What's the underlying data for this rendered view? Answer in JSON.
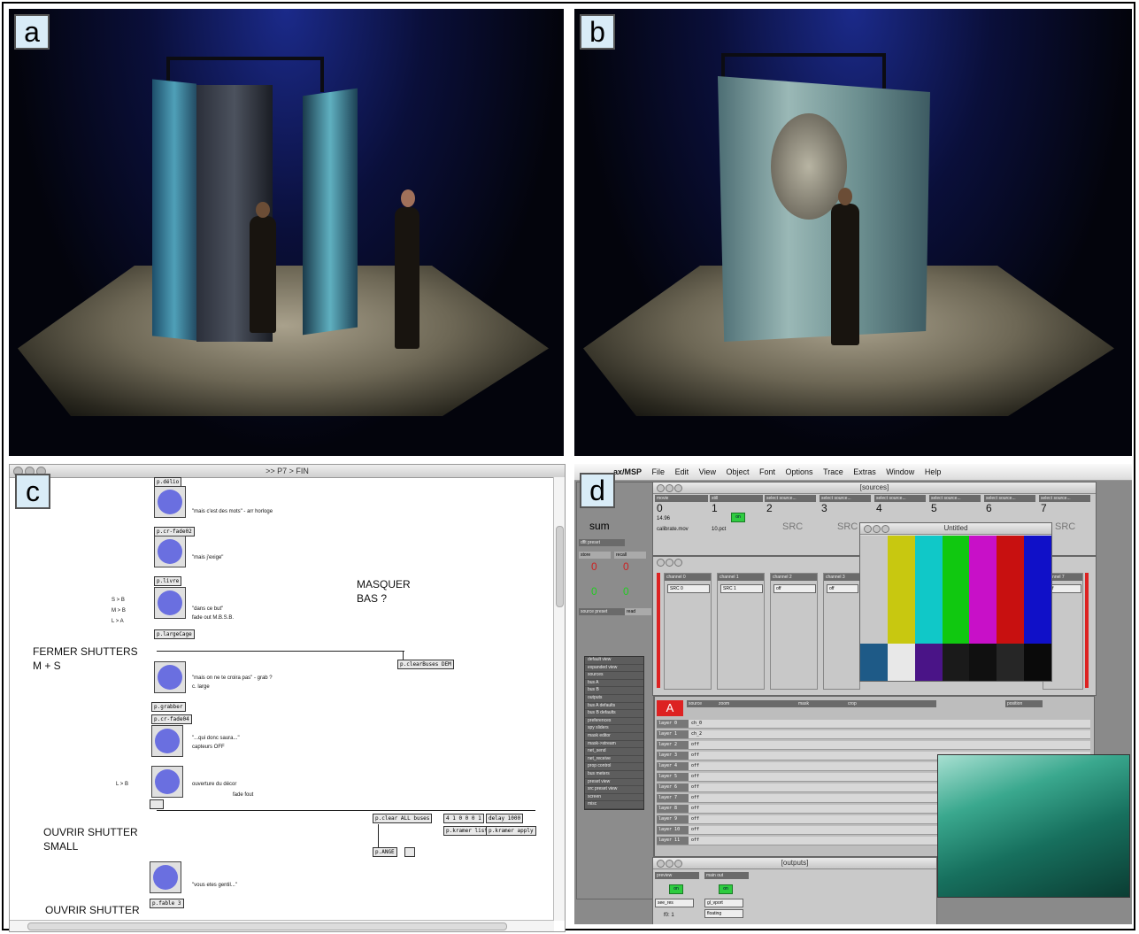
{
  "colors": {
    "stage_blue": "#1b2a8a",
    "bang_blue": "#6a6fe0",
    "max_gray": "#c9c9c9",
    "green_button": "#2ecc40",
    "red_label": "#d22222",
    "colorbars": [
      "#c8c8c8",
      "#c8c810",
      "#10c8c8",
      "#10c810",
      "#c810c8",
      "#c81010",
      "#1010c8"
    ],
    "colorbars_low": [
      "#1e5a87",
      "#e8e8e8",
      "#4a1487",
      "#1a1a1a",
      "#101010",
      "#262626",
      "#0a0a0a"
    ]
  },
  "panels": {
    "a": {
      "label": "a"
    },
    "b": {
      "label": "b"
    },
    "c": {
      "label": "c"
    },
    "d": {
      "label": "d"
    }
  },
  "patch": {
    "window_title": ">> P7 > FIN",
    "objects": {
      "o1": "p.délio",
      "o2": "p.cr-fade02",
      "o3": "p.livre",
      "o4": "p.largeCage",
      "o5": "p.clearBuses DEM",
      "o6": "p.grabber",
      "o7": "p.cr-fade04",
      "o8": "p.clear ALL buses",
      "o9": "4 1 0 0 0 1",
      "o10": "delay 1000",
      "o11": "p.kramer list",
      "o12": "p.kramer apply",
      "o13": "p.ANGE",
      "o14": "p.fable 3"
    },
    "comments": {
      "c1": "\"mais c'est des mots\" - arr horloge",
      "c2": "\"mais j'exige\"",
      "c3": "S > B",
      "c4": "M > B",
      "c5": "L > A",
      "c6": "\"dans ce but\"",
      "c7": "fade out M.B.S.B.",
      "c8": "\"mais on ne te croira pas\" - grab ?",
      "c9": "c. large",
      "c10": "\"...qui donc saura...\"",
      "c11": "capteurs OFF",
      "c12": "L > B",
      "c13": "ouverture du décor",
      "c14": "fade fout",
      "c15": "\"vous etes gentil...\""
    },
    "big_labels": {
      "masquer_1": "MASQUER",
      "masquer_2": "BAS ?",
      "fermer_1": "FERMER SHUTTERS",
      "fermer_2": "M + S",
      "ouvrir_small_1": "OUVRIR SHUTTER",
      "ouvrir_small_2": "SMALL",
      "ouvrir_3": "OUVRIR SHUTTER"
    }
  },
  "maxmsp": {
    "menubar": [
      "ax/MSP",
      "File",
      "Edit",
      "View",
      "Object",
      "Font",
      "Options",
      "Trace",
      "Extras",
      "Window",
      "Help"
    ],
    "sources_title": "[sources]",
    "untitled_title": "Untitled",
    "outputs_title": "[outputs]",
    "sum_label": "sum",
    "movie_hdr": "movie",
    "still_hdr": "still",
    "select_source": "select source...",
    "sources": [
      "0",
      "1",
      "2",
      "3",
      "4",
      "5",
      "6",
      "7"
    ],
    "src_text": "SRC",
    "movie_file": "calibrate.mov",
    "still_file": "10.pct",
    "time_value": "14.96",
    "on_label": "on",
    "channels": [
      "channel 0",
      "channel 1",
      "channel 2",
      "channel 3",
      "channel 7"
    ],
    "channel_values": [
      "SRC 0",
      "SRC 1",
      "off",
      "off",
      "off"
    ],
    "red_a": "A",
    "matrix_headers": [
      "source",
      "zoom",
      "mask",
      "crop",
      "position",
      "copy mode",
      "transp arence"
    ],
    "matrix_sub": [
      "zoom",
      "center x-y",
      "mask",
      "blur",
      "left",
      "top",
      "righ",
      "bottom",
      "grid",
      "x-y"
    ],
    "layers": [
      "layer 0",
      "layer 1",
      "layer 2",
      "layer 3",
      "layer 4",
      "layer 5",
      "layer 6",
      "layer 7",
      "layer 8",
      "layer 9",
      "layer 10",
      "layer 11"
    ],
    "layer_values": [
      "ch_0",
      "ch_2",
      "off",
      "off",
      "off",
      "off",
      "off",
      "off",
      "off",
      "off",
      "off",
      "off"
    ],
    "blend": "blend",
    "preset_labels": [
      "dflt preset",
      "store",
      "recall",
      "source preset",
      "store",
      "recall",
      "read"
    ],
    "preset_nums": [
      "0",
      "0",
      "0",
      "0"
    ],
    "side_menu": [
      "default view",
      "expanded view",
      "sources",
      "bus A",
      "bus B",
      "outputs",
      "bus A defaults",
      "bus B defaults",
      "preferences",
      "spy sliders",
      "mask editor",
      "mask->stream",
      "net_send",
      "net_receive",
      "prop control",
      "bus meters",
      "preset view",
      "src preset view",
      "screen",
      "misc"
    ],
    "outputs": {
      "preview": "preview",
      "main_out": "main out",
      "preview_value": "see_res",
      "main_value": "gl_vport",
      "floating": "floating",
      "f0": "f0: 1"
    }
  }
}
